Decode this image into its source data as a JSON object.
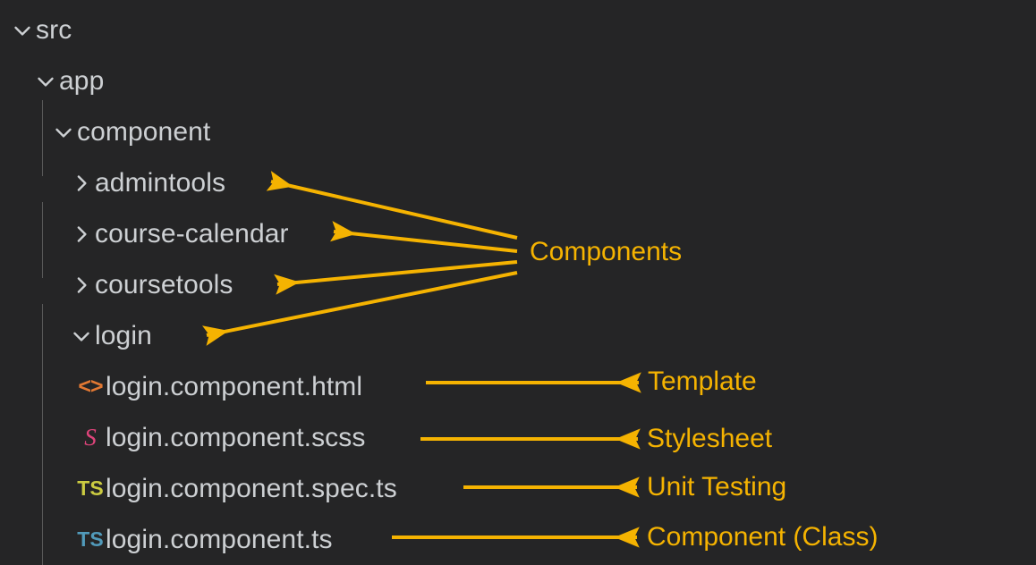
{
  "theme": {
    "background": "#252526",
    "text": "#cdd0d3",
    "annotation": "#F5B301",
    "guide": "#585858",
    "html_icon": "#E37933",
    "scss_icon": "#E0447B",
    "ts_spec_icon": "#CBCB41",
    "ts_icon": "#519ABA"
  },
  "tree": {
    "items": [
      {
        "label": "src",
        "twisty": "chevron-down-icon",
        "icon": null,
        "depth": 0
      },
      {
        "label": "app",
        "twisty": "chevron-down-icon",
        "icon": null,
        "depth": 1
      },
      {
        "label": "component",
        "twisty": "chevron-down-icon",
        "icon": null,
        "depth": 2
      },
      {
        "label": "admintools",
        "twisty": "chevron-right-icon",
        "icon": null,
        "depth": 3
      },
      {
        "label": "course-calendar",
        "twisty": "chevron-right-icon",
        "icon": null,
        "depth": 3
      },
      {
        "label": "coursetools",
        "twisty": "chevron-right-icon",
        "icon": null,
        "depth": 3
      },
      {
        "label": "login",
        "twisty": "chevron-down-icon",
        "icon": null,
        "depth": 3
      },
      {
        "label": "login.component.html",
        "twisty": null,
        "icon": "html-file-icon",
        "icon_text": "<>",
        "depth": 4
      },
      {
        "label": "login.component.scss",
        "twisty": null,
        "icon": "scss-file-icon",
        "icon_text": "S",
        "depth": 4
      },
      {
        "label": "login.component.spec.ts",
        "twisty": null,
        "icon": "ts-spec-file-icon",
        "icon_text": "TS",
        "depth": 4
      },
      {
        "label": "login.component.ts",
        "twisty": null,
        "icon": "ts-file-icon",
        "icon_text": "TS",
        "depth": 4
      }
    ]
  },
  "annotations": {
    "components": "Components",
    "template": "Template",
    "stylesheet": "Stylesheet",
    "unit_testing": "Unit Testing",
    "component_class": "Component (Class)"
  }
}
